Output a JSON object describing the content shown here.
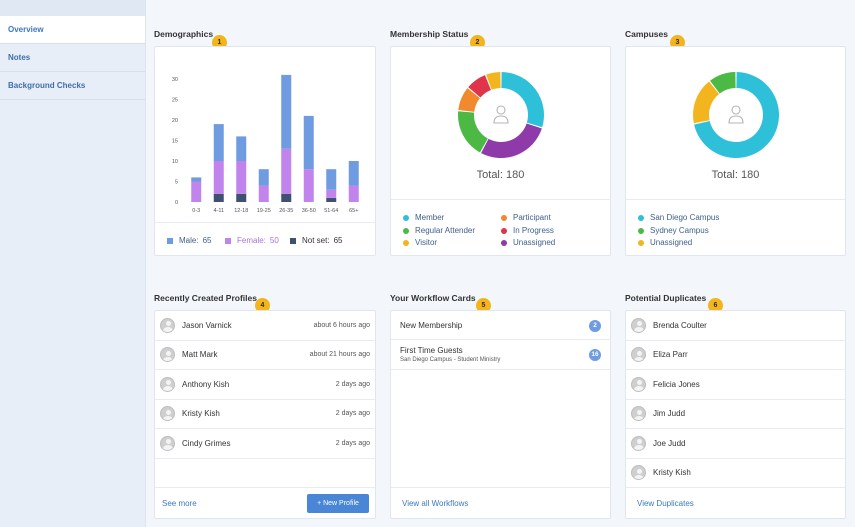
{
  "sidebar": {
    "items": [
      {
        "label": "Overview",
        "active": true
      },
      {
        "label": "Notes",
        "active": false
      },
      {
        "label": "Background Checks",
        "active": false
      }
    ]
  },
  "demographics": {
    "title": "Demographics",
    "badge": "1",
    "legend": {
      "male": "Male:",
      "male_count": "65",
      "female": "Female:",
      "female_count": "50",
      "notset": "Not set:",
      "notset_count": "65"
    }
  },
  "membership": {
    "title": "Membership Status",
    "badge": "2",
    "total": "Total: 180",
    "legend": [
      "Member",
      "Participant",
      "Regular Attender",
      "In Progress",
      "Visitor",
      "Unassigned"
    ]
  },
  "campuses": {
    "title": "Campuses",
    "badge": "3",
    "total": "Total: 180",
    "legend": [
      "San Diego Campus",
      "Sydney Campus",
      "Unassigned"
    ]
  },
  "profiles": {
    "title": "Recently Created Profiles",
    "badge": "4",
    "rows": [
      {
        "name": "Jason Varnick",
        "time": "about 6 hours ago"
      },
      {
        "name": "Matt Mark",
        "time": "about 21 hours ago"
      },
      {
        "name": "Anthony Kish",
        "time": "2 days ago"
      },
      {
        "name": "Kristy Kish",
        "time": "2 days ago"
      },
      {
        "name": "Cindy Grimes",
        "time": "2 days ago"
      }
    ],
    "see_more": "See more",
    "new_profile": "+ New Profile"
  },
  "workflow": {
    "title": "Your Workflow Cards",
    "badge": "5",
    "cards": [
      {
        "name": "New Membership",
        "sub": "",
        "count": "2"
      },
      {
        "name": "First Time Guests",
        "sub": "San Diego Campus - Student Ministry",
        "count": "16"
      }
    ],
    "view_all": "View all Workflows"
  },
  "duplicates": {
    "title": "Potential Duplicates",
    "badge": "6",
    "rows": [
      "Brenda Coulter",
      "Eliza Parr",
      "Felicia Jones",
      "Jim Judd",
      "Joe Judd",
      "Kristy Kish"
    ],
    "view": "View Duplicates"
  },
  "colors": {
    "male": "#6f9be0",
    "female": "#c183ec",
    "notset": "#3f5070",
    "member": "#2fc0d9",
    "participant": "#f08a2c",
    "regular": "#4cb944",
    "inprogress": "#e0344a",
    "visitor": "#f2b51d",
    "unassigned": "#8e3aa8",
    "accent": "#4a86d6"
  },
  "chart_data": [
    {
      "type": "bar",
      "stacked": true,
      "categories": [
        "0-3",
        "4-11",
        "12-18",
        "19-25",
        "26-35",
        "36-50",
        "51-64",
        "65+"
      ],
      "series": [
        {
          "name": "Male",
          "values": [
            1,
            9,
            6,
            4,
            18,
            13,
            5,
            6
          ]
        },
        {
          "name": "Female",
          "values": [
            5,
            8,
            8,
            4,
            11,
            8,
            2,
            4
          ]
        },
        {
          "name": "Not set",
          "values": [
            0,
            2,
            2,
            0,
            2,
            0,
            1,
            0
          ]
        }
      ],
      "yticks": [
        0,
        5,
        10,
        15,
        20,
        25,
        30
      ],
      "ylim": [
        0,
        32
      ]
    },
    {
      "type": "pie",
      "labels": [
        "Member",
        "Unassigned",
        "Regular Attender",
        "Participant",
        "In Progress",
        "Visitor"
      ],
      "values": [
        51,
        48,
        32,
        16,
        14,
        10
      ],
      "total": 180
    },
    {
      "type": "pie",
      "labels": [
        "San Diego Campus",
        "Sydney Campus",
        "Unassigned"
      ],
      "values": [
        129,
        32,
        19
      ],
      "total": 180
    }
  ]
}
